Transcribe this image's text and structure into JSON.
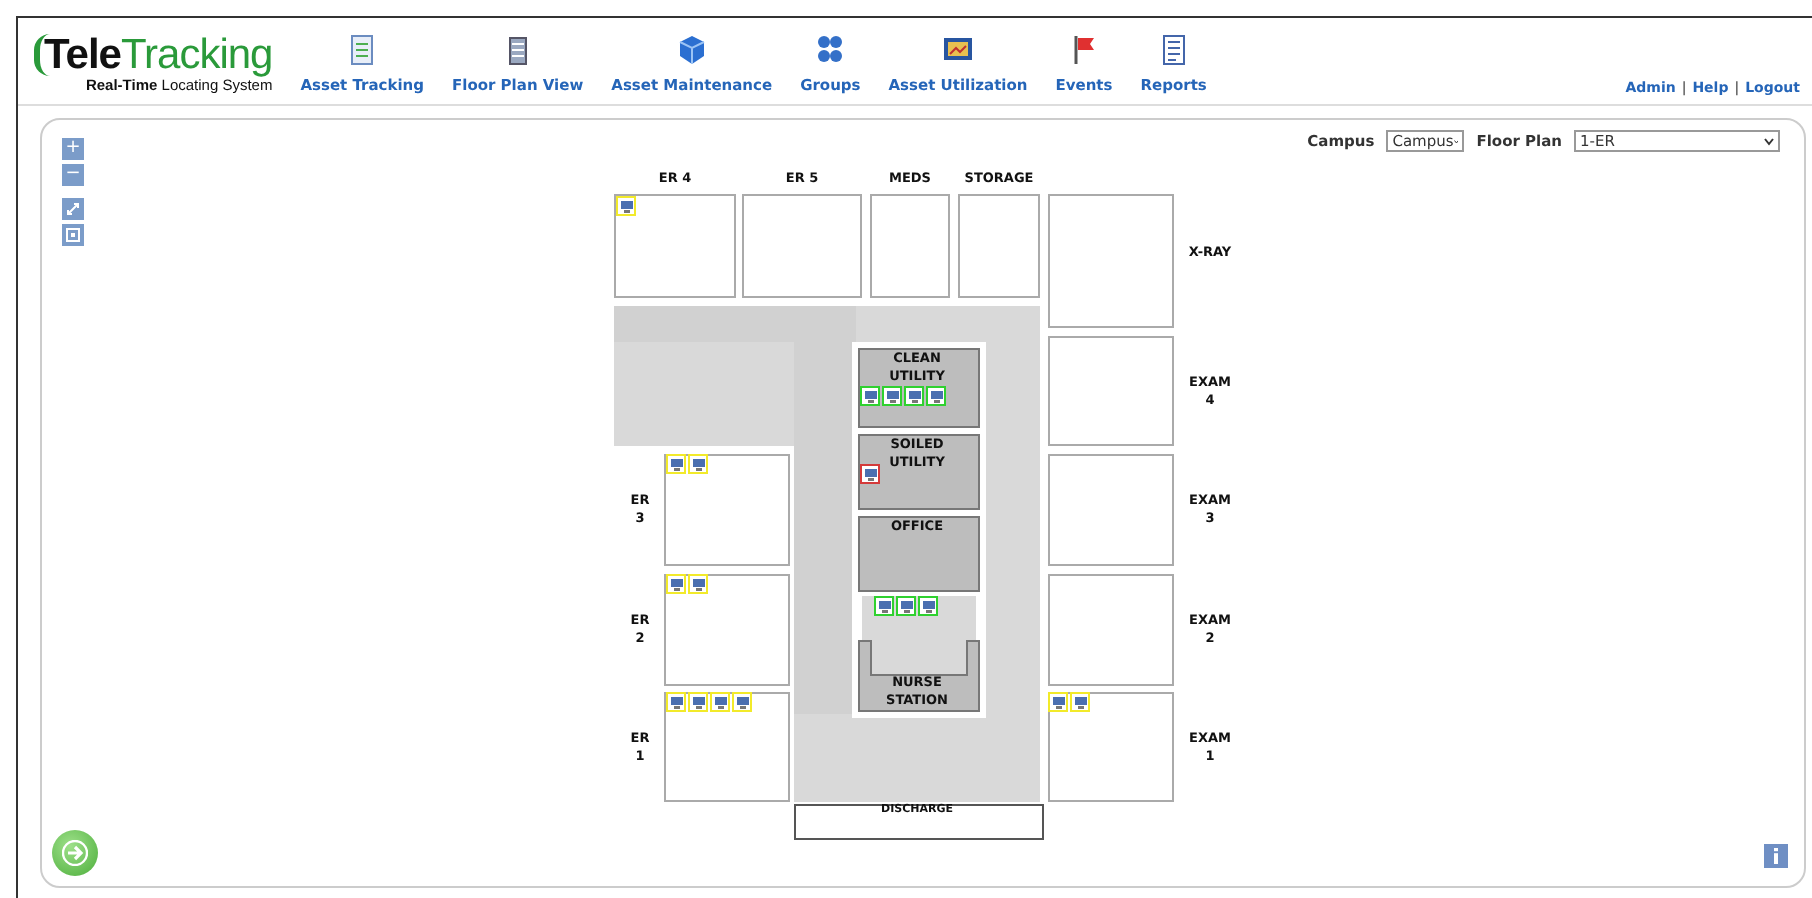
{
  "logo": {
    "part_1": "Tele",
    "part_2": "Tracking",
    "tagline": "**Real-Time** Locating System"
  },
  "nav": [
    {
      "label": "Asset Tracking",
      "kind": "checklist"
    },
    {
      "label": "Floor Plan View",
      "kind": "building"
    },
    {
      "label": "Asset Maintenance",
      "kind": "cube"
    },
    {
      "label": "Groups",
      "kind": "groups"
    },
    {
      "label": "Asset Utilization",
      "kind": "chart"
    },
    {
      "label": "Events",
      "kind": "flag"
    },
    {
      "label": "Reports",
      "kind": "report"
    }
  ],
  "user_links": {
    "items": [
      "Admin",
      "Help",
      "Logout"
    ],
    "separator": "|"
  },
  "zoom_controls": [
    {
      "kind": "text",
      "label": "+"
    },
    {
      "kind": "text",
      "label": "−"
    },
    {
      "kind": "expand"
    },
    {
      "kind": "fit"
    }
  ],
  "filters": {
    "campus_label": "Campus",
    "campus_value": "Campus",
    "floor_label": "Floor Plan",
    "floor_value": "1-ER"
  },
  "rooms": [
    {
      "label": "ER 4",
      "kind": "room",
      "assets": [
        {
          "color": "#f2ea2a"
        }
      ]
    },
    {
      "label": "ER 5",
      "kind": "room"
    },
    {
      "label": "MEDS",
      "kind": "room"
    },
    {
      "label": "STORAGE",
      "kind": "room"
    },
    {
      "label": "X-RAY",
      "kind": "room"
    },
    {
      "label": "EXAM 4",
      "kind": "room"
    },
    {
      "label": "CLEAN UTILITY",
      "kind": "utility",
      "assets": [
        {
          "color": "#2fd12f"
        },
        {
          "color": "#2fd12f"
        },
        {
          "color": "#2fd12f"
        },
        {
          "color": "#2fd12f"
        }
      ]
    },
    {
      "label": "SOILED UTILITY",
      "kind": "utility",
      "assets": [
        {
          "color": "#d43a3a"
        }
      ]
    },
    {
      "label": "ER 3",
      "kind": "room",
      "assets": [
        {
          "color": "#f2ea2a"
        },
        {
          "color": "#f2ea2a"
        }
      ]
    },
    {
      "label": "EXAM 3",
      "kind": "room"
    },
    {
      "label": "OFFICE",
      "kind": "utility"
    },
    {
      "label": "ER 2",
      "kind": "room",
      "assets": [
        {
          "color": "#f2ea2a"
        },
        {
          "color": "#f2ea2a"
        }
      ]
    },
    {
      "label": "EXAM 2",
      "kind": "room"
    },
    {
      "label": "NURSE STATION",
      "kind": "station",
      "assets": [
        {
          "color": "#2fd12f"
        },
        {
          "color": "#2fd12f"
        },
        {
          "color": "#2fd12f"
        }
      ]
    },
    {
      "label": "ER 1",
      "kind": "room",
      "assets": [
        {
          "color": "#f2ea2a"
        },
        {
          "color": "#f2ea2a"
        },
        {
          "color": "#f2ea2a"
        },
        {
          "color": "#f2ea2a"
        }
      ]
    },
    {
      "label": "EXAM 1",
      "kind": "room",
      "assets": [
        {
          "color": "#f2ea2a"
        },
        {
          "color": "#f2ea2a"
        }
      ]
    },
    {
      "label": "DISCHARGE",
      "kind": "exit"
    }
  ]
}
